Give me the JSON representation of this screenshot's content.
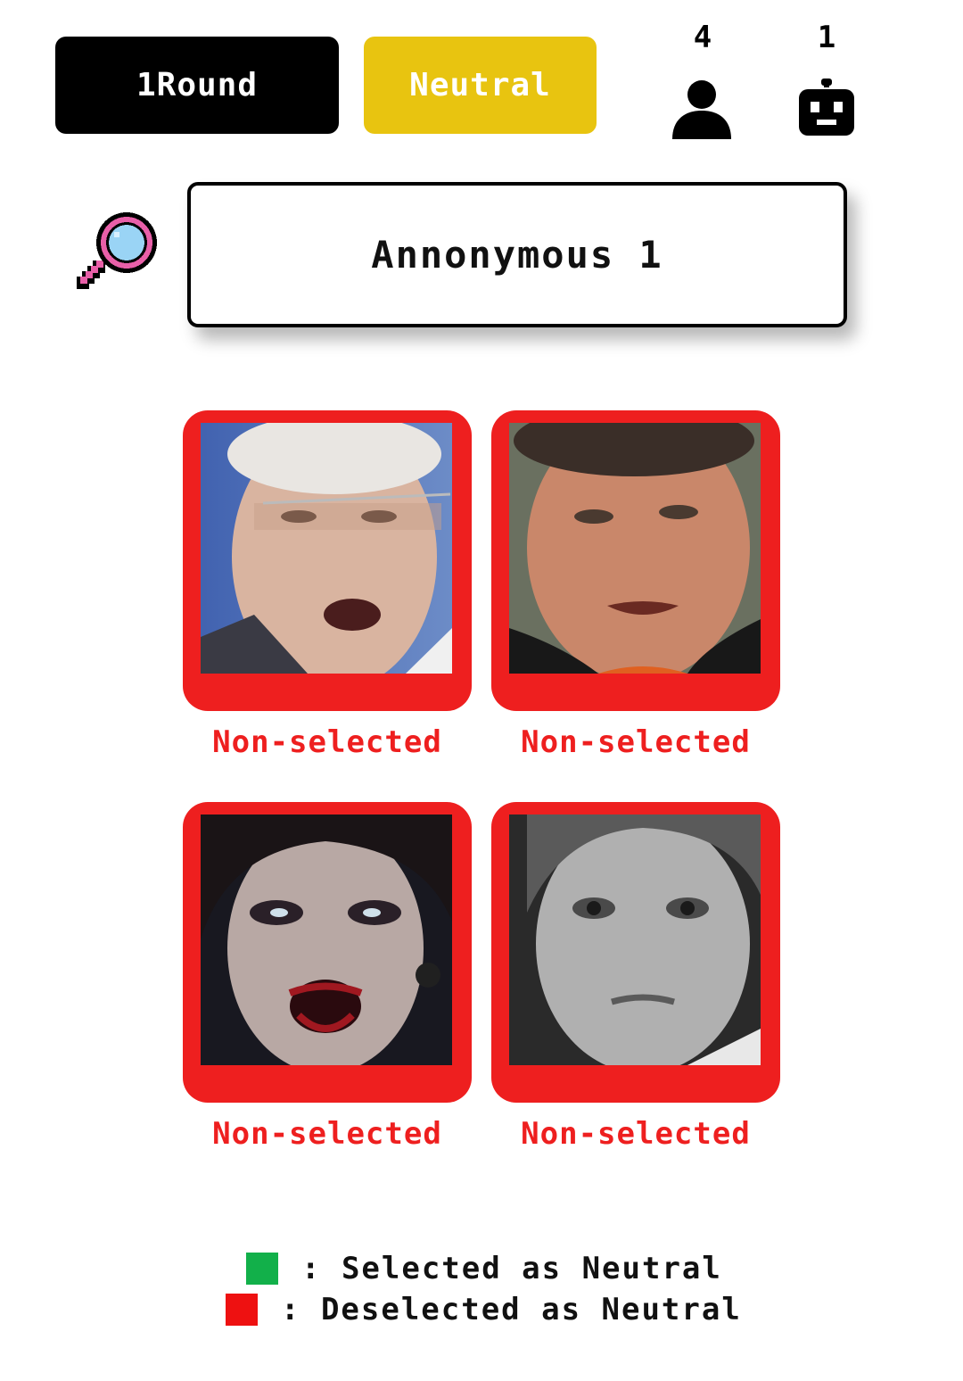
{
  "header": {
    "round_label": "1Round",
    "mode_label": "Neutral",
    "human_count": "4",
    "bot_count": "1"
  },
  "search": {
    "player_name": "Annonymous 1"
  },
  "cards": [
    {
      "status": "Non-selected"
    },
    {
      "status": "Non-selected"
    },
    {
      "status": "Non-selected"
    },
    {
      "status": "Non-selected"
    }
  ],
  "legend": {
    "selected_text": ": Selected as Neutral",
    "deselected_text": ": Deselected as Neutral",
    "selected_color": "#12b04a",
    "deselected_color": "#ee1111"
  },
  "colors": {
    "accent_yellow": "#e8c410",
    "card_red": "#ee1f1f",
    "round_black": "#000000"
  }
}
